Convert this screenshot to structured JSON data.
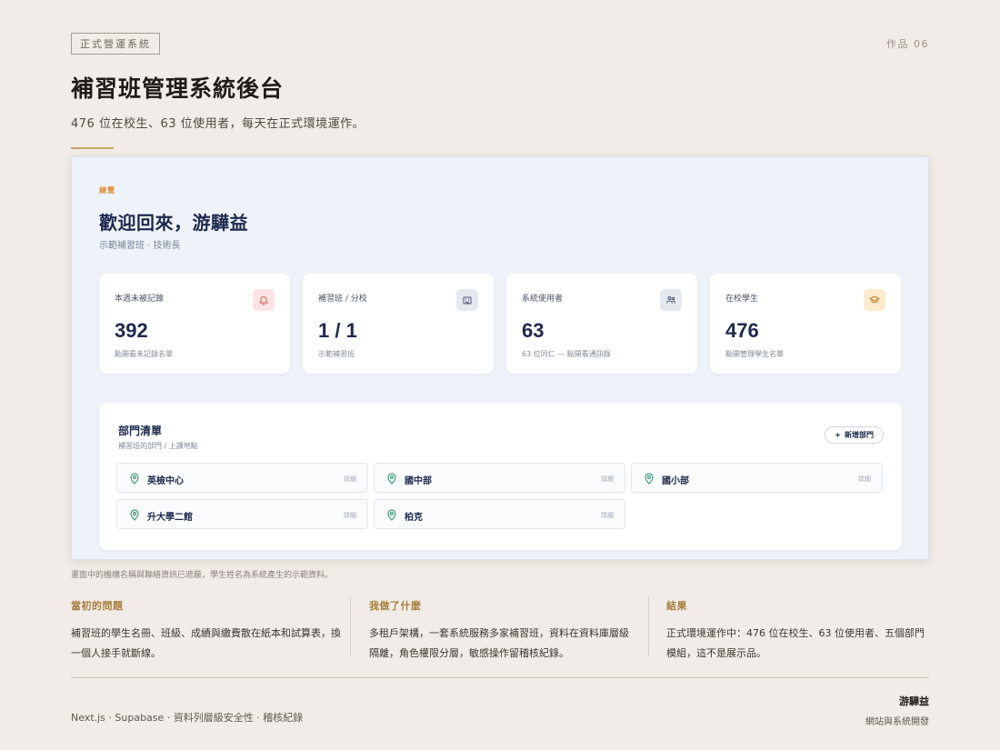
{
  "header": {
    "tag": "正式營運系統",
    "work_no": "作品 06",
    "title": "補習班管理系統後台",
    "subtitle": "476 位在校生、63 位使用者，每天在正式環境運作。"
  },
  "dashboard": {
    "kicker": "總覽",
    "welcome": "歡迎回來，游驊益",
    "role": "示範補習班 · 技術長",
    "stats": [
      {
        "label": "本週未被記錄",
        "value": "392",
        "hint": "點開看未記錄名單",
        "icon": "bell-icon"
      },
      {
        "label": "補習班 / 分校",
        "value": "1 / 1",
        "hint": "示範補習班",
        "icon": "building-icon"
      },
      {
        "label": "系統使用者",
        "value": "63",
        "hint": "63 位同仁 — 點開看通訊錄",
        "icon": "users-icon"
      },
      {
        "label": "在校學生",
        "value": "476",
        "hint": "點開管理學生名單",
        "icon": "graduation-cap-icon"
      }
    ],
    "departments": {
      "title": "部門清單",
      "subtitle": "補習班的部門 / 上課地點",
      "add_label": "新增部門",
      "detail_label": "詳細",
      "items": [
        "英檢中心",
        "國中部",
        "國小部",
        "升大學二館",
        "柏克"
      ]
    },
    "colors": {
      "accent": "#e08a2e",
      "navy": "#1d2a4d",
      "pin": "#3f9d7d"
    }
  },
  "caption": "畫面中的機構名稱與聯絡資訊已遮蔽，學生姓名為系統產生的示範資料。",
  "columns": [
    {
      "heading": "當初的問題",
      "body": "補習班的學生名冊、班級、成績與繳費散在紙本和試算表，換一個人接手就斷線。"
    },
    {
      "heading": "我做了什麼",
      "body": "多租戶架構，一套系統服務多家補習班，資料在資料庫層級隔離，角色權限分層，敏感操作留稽核紀錄。"
    },
    {
      "heading": "結果",
      "body": "正式環境運作中：476 位在校生、63 位使用者、五個部門模組，這不是展示品。"
    }
  ],
  "footer": {
    "stack": "Next.js · Supabase · 資料列層級安全性 · 稽核紀錄",
    "author": "游驊益",
    "author_role": "網站與系統開發"
  }
}
